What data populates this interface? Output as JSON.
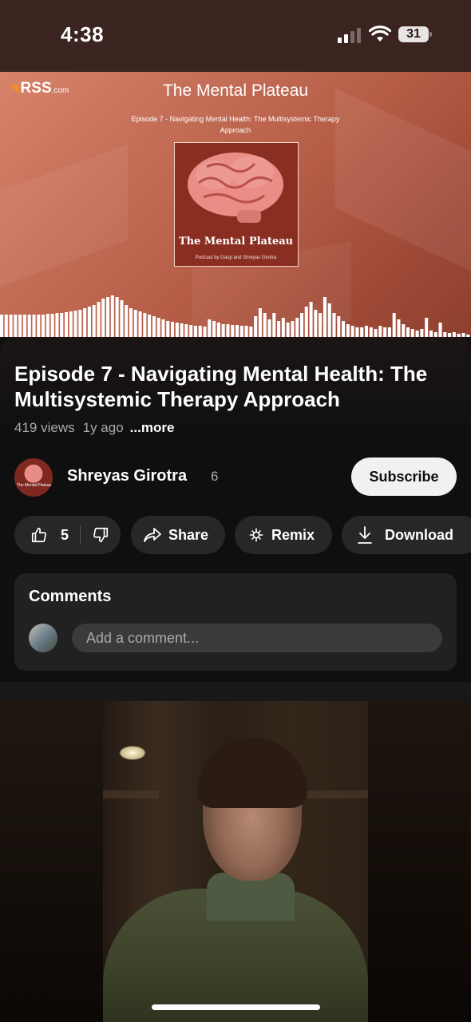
{
  "status_bar": {
    "time": "4:38",
    "battery": "31",
    "icons": [
      "signal-icon",
      "wifi-icon",
      "battery-icon"
    ]
  },
  "player": {
    "brand": "RSS",
    "brand_suffix": ".com",
    "podcast_title": "The Mental Plateau",
    "episode_subtitle": "Episode 7 - Navigating Mental Health: The Multisystemic Therapy Approach",
    "cover_title": "The Mental Plateau",
    "cover_byline": "Podcast by Gargi and Shreyas Girotra"
  },
  "video": {
    "title": "Episode 7 - Navigating Mental Health: The Multisystemic Therapy Approach",
    "views": "419 views",
    "age": "1y ago",
    "more_label": "...more"
  },
  "channel": {
    "name": "Shreyas Girotra",
    "subscriber_count": "6",
    "subscribe_label": "Subscribe",
    "avatar_text": "The Mental Plateau"
  },
  "actions": {
    "like_count": "5",
    "share_label": "Share",
    "remix_label": "Remix",
    "download_label": "Download"
  },
  "comments": {
    "title": "Comments",
    "placeholder": "Add a comment..."
  },
  "colors": {
    "background": "#0f0f0f",
    "pill": "#272727",
    "subscribe_bg": "#f1f1f1",
    "secondary_text": "#aaaaaa"
  }
}
